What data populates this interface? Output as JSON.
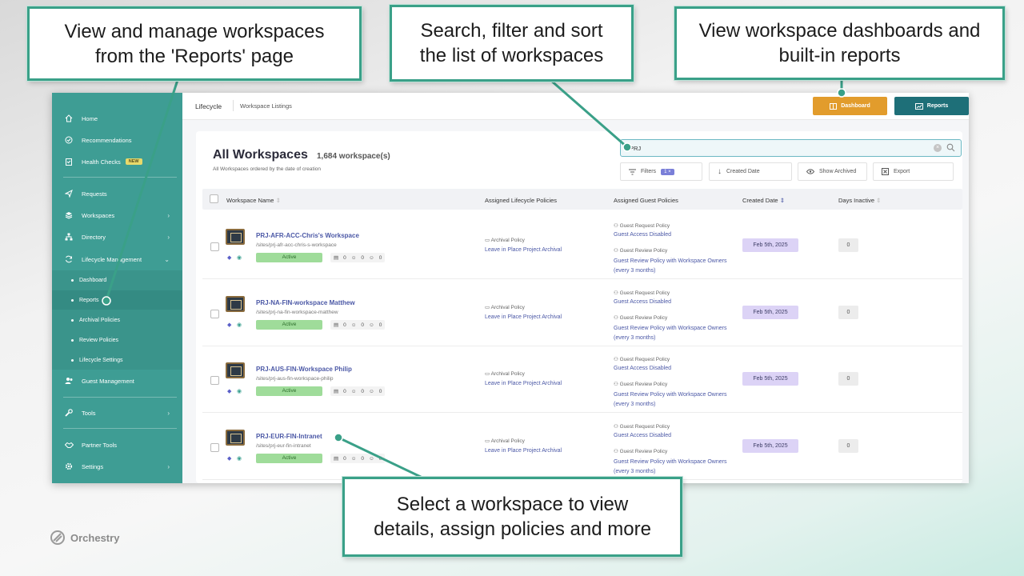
{
  "sidebar": {
    "items": [
      {
        "label": "Home"
      },
      {
        "label": "Recommendations"
      },
      {
        "label": "Health Checks",
        "badge": "NEW"
      },
      {
        "label": "Requests"
      },
      {
        "label": "Workspaces"
      },
      {
        "label": "Directory"
      },
      {
        "label": "Lifecycle Management"
      },
      {
        "label": "Guest Management"
      },
      {
        "label": "Tools"
      },
      {
        "label": "Partner Tools"
      },
      {
        "label": "Settings"
      }
    ],
    "sub_items": [
      {
        "label": "Dashboard"
      },
      {
        "label": "Reports"
      },
      {
        "label": "Archival Policies"
      },
      {
        "label": "Review Policies"
      },
      {
        "label": "Lifecycle Settings"
      }
    ]
  },
  "header": {
    "breadcrumb_1": "Lifecycle",
    "breadcrumb_2": "Workspace Listings",
    "dashboard_label": "Dashboard",
    "reports_label": "Reports"
  },
  "main": {
    "title": "All Workspaces",
    "count": "1,684 workspace(s)",
    "subtitle": "All Workspaces ordered by the date of creation",
    "search_value": "PRJ",
    "filters_label": "Filters",
    "filters_count": "1",
    "created_date_label": "Created Date",
    "show_archived_label": "Show Archived",
    "export_label": "Export",
    "columns": [
      "Workspace Name",
      "Assigned Lifecycle Policies",
      "Assigned Guest Policies",
      "Created Date",
      "Days Inactive"
    ]
  },
  "rows": [
    {
      "name": "PRJ-AFR-ACC-Chris's Workspace",
      "url": "/sites/prj-afr-acc-chris-s-workspace",
      "status": "Active",
      "meta": [
        "0",
        "0",
        "0"
      ],
      "lifecycle_label": "Archival Policy",
      "lifecycle_value": "Leave in Place Project Archival",
      "guest_label_1": "Guest Request Policy",
      "guest_value_1": "Guest Access Disabled",
      "guest_label_2": "Guest Review Policy",
      "guest_value_2": "Guest Review Policy with Workspace Owners (every 3 months)",
      "created": "Feb 5th, 2025",
      "days_inactive": "0"
    },
    {
      "name": "PRJ-NA-FIN-workspace Matthew",
      "url": "/sites/prj-na-fin-workspace-matthew",
      "status": "Active",
      "meta": [
        "0",
        "0",
        "0"
      ],
      "lifecycle_label": "Archival Policy",
      "lifecycle_value": "Leave in Place Project Archival",
      "guest_label_1": "Guest Request Policy",
      "guest_value_1": "Guest Access Disabled",
      "guest_label_2": "Guest Review Policy",
      "guest_value_2": "Guest Review Policy with Workspace Owners (every 3 months)",
      "created": "Feb 5th, 2025",
      "days_inactive": "0"
    },
    {
      "name": "PRJ-AUS-FIN-Workspace Philip",
      "url": "/sites/prj-aus-fin-workspace-philip",
      "status": "Active",
      "meta": [
        "0",
        "0",
        "0"
      ],
      "lifecycle_label": "Archival Policy",
      "lifecycle_value": "Leave in Place Project Archival",
      "guest_label_1": "Guest Request Policy",
      "guest_value_1": "Guest Access Disabled",
      "guest_label_2": "Guest Review Policy",
      "guest_value_2": "Guest Review Policy with Workspace Owners (every 3 months)",
      "created": "Feb 5th, 2025",
      "days_inactive": "0"
    },
    {
      "name": "PRJ-EUR-FIN-Intranet",
      "url": "/sites/prj-eur-fin-intranet",
      "status": "Active",
      "meta": [
        "0",
        "0",
        "0"
      ],
      "lifecycle_label": "Archival Policy",
      "lifecycle_value": "Leave in Place Project Archival",
      "guest_label_1": "Guest Request Policy",
      "guest_value_1": "Guest Access Disabled",
      "guest_label_2": "Guest Review Policy",
      "guest_value_2": "Guest Review Policy with Workspace Owners (every 3 months)",
      "created": "Feb 5th, 2025",
      "days_inactive": "0"
    }
  ],
  "callouts": {
    "reports": "View and manage workspaces\nfrom the 'Reports' page",
    "search": "Search, filter and sort\nthe list of workspaces",
    "dashboards": "View workspace dashboards and\nbuilt-in reports",
    "select": "Select a workspace to view\ndetails, assign policies and more"
  },
  "brand": {
    "name": "Orchestry"
  },
  "colors": {
    "accent": "#3aa088",
    "sidebar": "#3e9d94",
    "dashboard_button": "#e29c2c",
    "reports_button": "#1e6f78",
    "link": "#4b58a6"
  }
}
